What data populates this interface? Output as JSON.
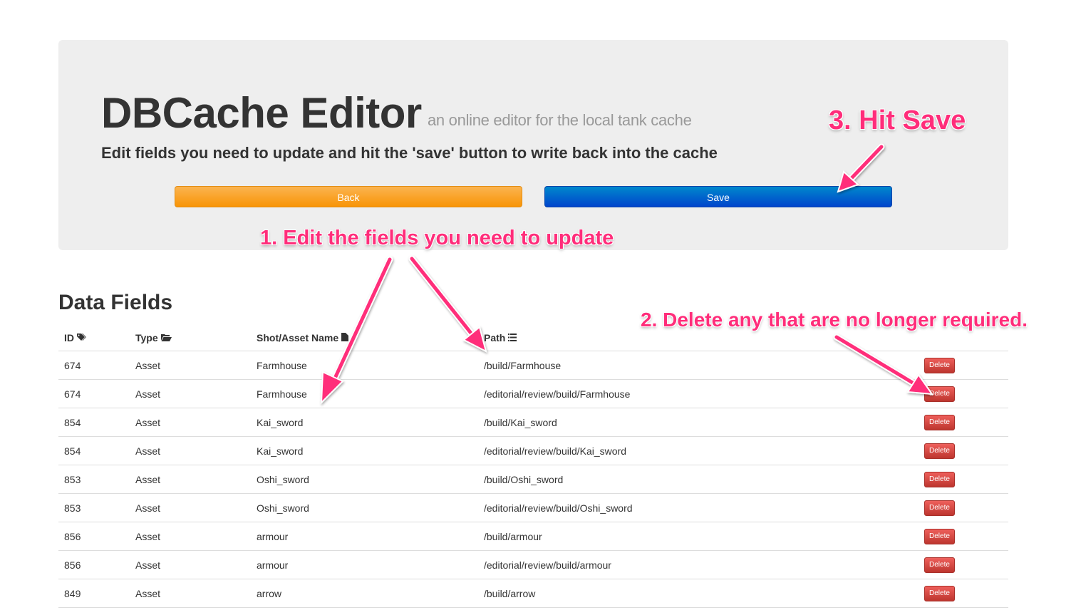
{
  "header": {
    "title": "DBCache Editor",
    "subtitle": "an online editor for the local tank cache",
    "instructions": "Edit fields you need to update and hit the 'save' button to write back into the cache",
    "back_label": "Back",
    "save_label": "Save"
  },
  "section": {
    "title": "Data Fields"
  },
  "table": {
    "columns": [
      {
        "label": "ID",
        "icon": "tags-icon"
      },
      {
        "label": "Type",
        "icon": "folder-open-icon"
      },
      {
        "label": "Shot/Asset Name",
        "icon": "file-icon"
      },
      {
        "label": "Path",
        "icon": "list-icon"
      }
    ],
    "delete_label": "Delete",
    "rows": [
      {
        "id": "674",
        "type": "Asset",
        "name": "Farmhouse",
        "path": "/build/Farmhouse"
      },
      {
        "id": "674",
        "type": "Asset",
        "name": "Farmhouse",
        "path": "/editorial/review/build/Farmhouse"
      },
      {
        "id": "854",
        "type": "Asset",
        "name": "Kai_sword",
        "path": "/build/Kai_sword"
      },
      {
        "id": "854",
        "type": "Asset",
        "name": "Kai_sword",
        "path": "/editorial/review/build/Kai_sword"
      },
      {
        "id": "853",
        "type": "Asset",
        "name": "Oshi_sword",
        "path": "/build/Oshi_sword"
      },
      {
        "id": "853",
        "type": "Asset",
        "name": "Oshi_sword",
        "path": "/editorial/review/build/Oshi_sword"
      },
      {
        "id": "856",
        "type": "Asset",
        "name": "armour",
        "path": "/build/armour"
      },
      {
        "id": "856",
        "type": "Asset",
        "name": "armour",
        "path": "/editorial/review/build/armour"
      },
      {
        "id": "849",
        "type": "Asset",
        "name": "arrow",
        "path": "/build/arrow"
      }
    ]
  },
  "annotations": {
    "step1": "1. Edit the fields you need to update",
    "step2": "2. Delete any that are no longer required.",
    "step3": "3. Hit Save"
  },
  "colors": {
    "back_button": "#f89406",
    "save_button": "#0044cc",
    "delete_button": "#bd362f",
    "annotation": "#ff2d7a",
    "hero_background": "#eeeeee"
  }
}
